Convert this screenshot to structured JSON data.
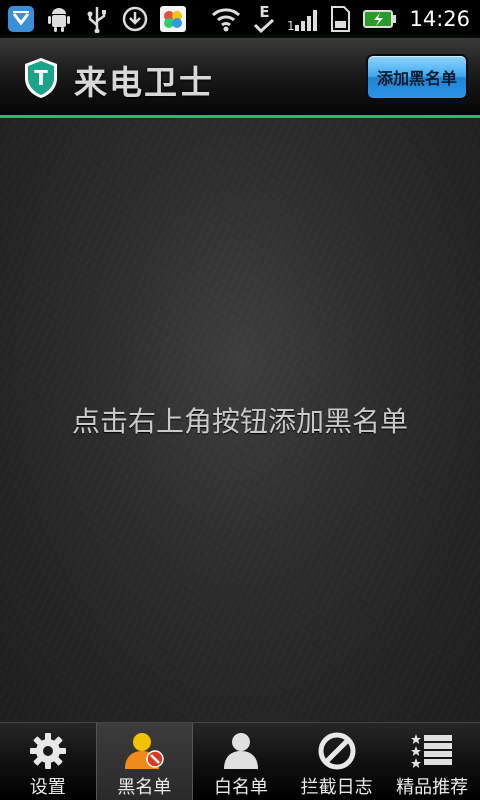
{
  "status_bar": {
    "time": "14:26",
    "network_type": "E",
    "icons": [
      "shield-app-icon",
      "android-debug-icon",
      "usb-icon",
      "download-icon",
      "app-notification-icon",
      "wifi-icon",
      "data-sync-icon",
      "signal-icon",
      "sd-card-icon",
      "battery-charging-icon"
    ]
  },
  "header": {
    "title": "来电卫士",
    "logo_letter": "T",
    "add_blacklist_label": "添加黑名单"
  },
  "main": {
    "empty_hint": "点击右上角按钮添加黑名单"
  },
  "bottom_nav": {
    "items": [
      {
        "label": "设置",
        "icon": "gear-icon",
        "active": false
      },
      {
        "label": "黑名单",
        "icon": "blacklist-user-icon",
        "active": true
      },
      {
        "label": "白名单",
        "icon": "user-icon",
        "active": false
      },
      {
        "label": "拦截日志",
        "icon": "block-icon",
        "active": false
      },
      {
        "label": "精品推荐",
        "icon": "star-list-icon",
        "active": false
      }
    ]
  },
  "colors": {
    "accent_green": "#27c24a",
    "button_blue": "#3fa9ee",
    "logo_teal": "#1aa58a"
  }
}
